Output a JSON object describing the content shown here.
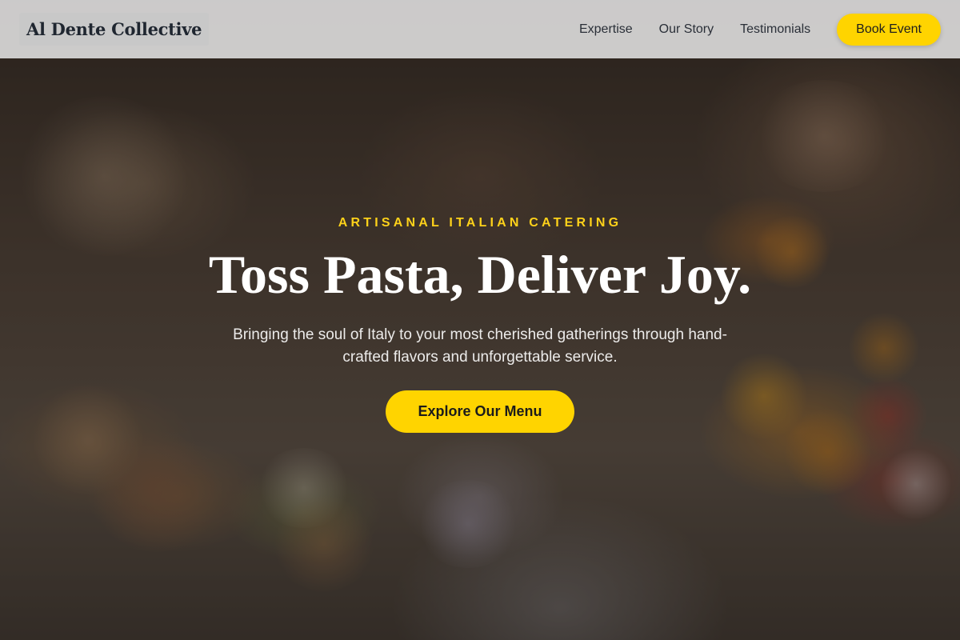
{
  "header": {
    "logo": "Al Dente Collective",
    "nav": [
      "Expertise",
      "Our Story",
      "Testimonials"
    ],
    "book_label": "Book Event"
  },
  "hero": {
    "eyebrow": "ARTISANAL ITALIAN CATERING",
    "headline": "Toss Pasta, Deliver Joy.",
    "subtitle": "Bringing the soul of Italy to your most cherished gatherings through hand-crafted flavors and unforgettable service.",
    "cta_label": "Explore Our Menu"
  },
  "colors": {
    "accent": "#ffd400",
    "eyebrow": "#ffd21a",
    "header_bg": "#e6e6e6"
  }
}
